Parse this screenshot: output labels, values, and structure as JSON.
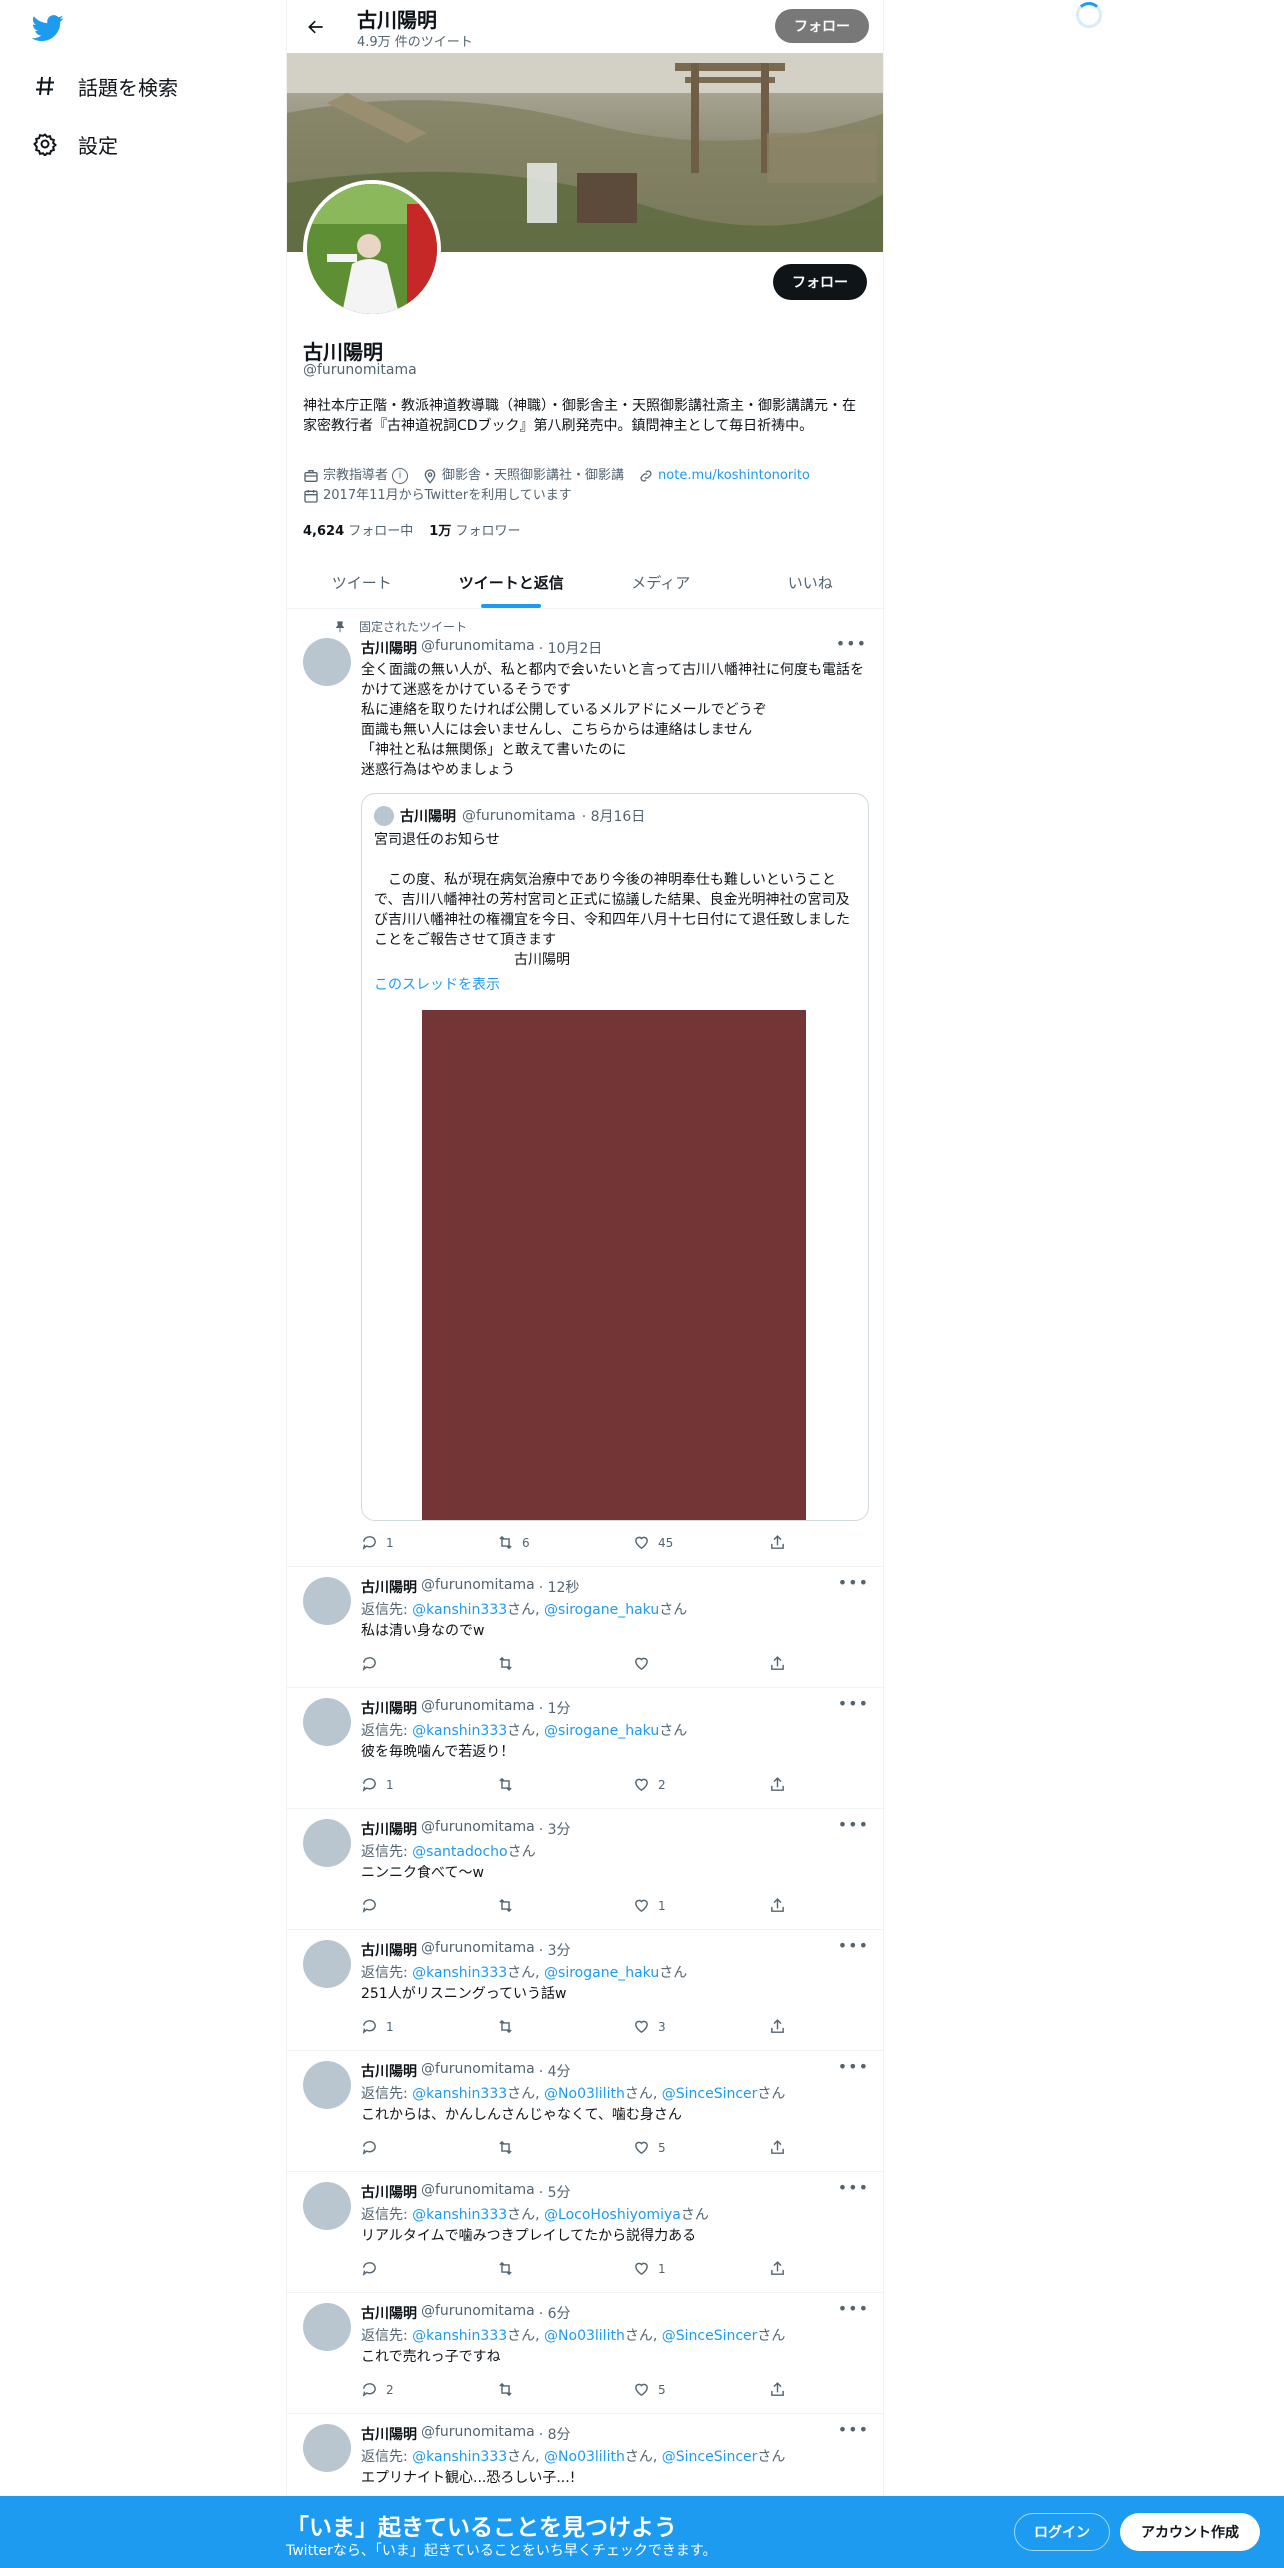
{
  "nav": {
    "explore_label": "話題を検索",
    "settings_label": "設定"
  },
  "topbar": {
    "name": "古川陽明",
    "tweet_count": "4.9万 件のツイート",
    "follow_label": "フォロー"
  },
  "profile": {
    "name": "古川陽明",
    "handle": "@furunomitama",
    "bio": "神社本庁正階・教派神道教導職（神職）・御影舎主・天照御影講社斎主・御影講講元・在家密教行者『古神道祝詞CDブック』第八刷発売中。鎮問神主として毎日祈祷中。",
    "category": "宗教指導者",
    "location": "御影舎・天照御影講社・御影講",
    "url": "note.mu/koshintonorito",
    "joined": "2017年11月からTwitterを利用しています",
    "following_count": "4,624",
    "following_label": "フォロー中",
    "followers_count": "1万",
    "followers_label": "フォロワー",
    "follow_label": "フォロー"
  },
  "tabs": [
    "ツイート",
    "ツイートと返信",
    "メディア",
    "いいね"
  ],
  "pinned_label": "固定されたツイート",
  "pinned_tweet": {
    "name": "古川陽明",
    "handle": "@furunomitama",
    "time": "· 10月2日",
    "text": "全く面識の無い人が、私と都内で会いたいと言って古川八幡神社に何度も電話をかけて迷惑をかけているそうです\n私に連絡を取りたければ公開しているメルアドにメールでどうぞ\n面識も無い人には会いませんし、こちらからは連絡はしません\n「神社と私は無関係」と敢えて書いたのに\n迷惑行為はやめましょう",
    "quote": {
      "name": "古川陽明",
      "handle": "@furunomitama",
      "time": "· 8月16日",
      "text": "宮司退任のお知らせ\n\n　この度、私が現在病気治療中であり今後の神明奉仕も難しいということで、吉川八幡神社の芳村宮司と正式に協議した結果、良金光明神社の宮司及び吉川八幡神社の権禰宜を今日、令和四年八月十七日付にて退任致しましたことをご報告させて頂きます\n　　　　　　　　　　古川陽明",
      "thread_link": "このスレッドを表示"
    },
    "replies": "1",
    "retweets": "6",
    "likes": "45"
  },
  "tweets": [
    {
      "name": "古川陽明",
      "handle": "@furunomitama",
      "time": "· 12秒",
      "reply_prefix": "返信先: ",
      "mentions": [
        "@kanshin333",
        "@sirogane_haku"
      ],
      "text": "私は清い身なのでw",
      "replies": "",
      "retweets": "",
      "likes": ""
    },
    {
      "name": "古川陽明",
      "handle": "@furunomitama",
      "time": "· 1分",
      "reply_prefix": "返信先: ",
      "mentions": [
        "@kanshin333",
        "@sirogane_haku"
      ],
      "text": "彼を毎晩噛んで若返り！",
      "replies": "1",
      "retweets": "",
      "likes": "2"
    },
    {
      "name": "古川陽明",
      "handle": "@furunomitama",
      "time": "· 3分",
      "reply_prefix": "返信先: ",
      "mentions": [
        "@santadocho"
      ],
      "text": "ニンニク食べて〜w",
      "replies": "",
      "retweets": "",
      "likes": "1"
    },
    {
      "name": "古川陽明",
      "handle": "@furunomitama",
      "time": "· 3分",
      "reply_prefix": "返信先: ",
      "mentions": [
        "@kanshin333",
        "@sirogane_haku"
      ],
      "text": "251人がリスニングっていう話w",
      "replies": "1",
      "retweets": "",
      "likes": "3"
    },
    {
      "name": "古川陽明",
      "handle": "@furunomitama",
      "time": "· 4分",
      "reply_prefix": "返信先: ",
      "mentions": [
        "@kanshin333",
        "@No03lilith",
        "@SinceSincer"
      ],
      "text": "これからは、かんしんさんじゃなくて、噛む身さん",
      "replies": "",
      "retweets": "",
      "likes": "5"
    },
    {
      "name": "古川陽明",
      "handle": "@furunomitama",
      "time": "· 5分",
      "reply_prefix": "返信先: ",
      "mentions": [
        "@kanshin333",
        "@LocoHoshiyomiya"
      ],
      "text": "リアルタイムで噛みつきプレイしてたから説得力ある",
      "replies": "",
      "retweets": "",
      "likes": "1"
    },
    {
      "name": "古川陽明",
      "handle": "@furunomitama",
      "time": "· 6分",
      "reply_prefix": "返信先: ",
      "mentions": [
        "@kanshin333",
        "@No03lilith",
        "@SinceSincer"
      ],
      "text": "これで売れっ子ですね",
      "replies": "2",
      "retweets": "",
      "likes": "5"
    },
    {
      "name": "古川陽明",
      "handle": "@furunomitama",
      "time": "· 8分",
      "reply_prefix": "返信先: ",
      "mentions": [
        "@kanshin333",
        "@No03lilith",
        "@SinceSincer"
      ],
      "text": "エプリナイト観心...恐ろしい子...!",
      "replies": "",
      "retweets": "",
      "likes": ""
    }
  ],
  "mention_suffix": "さん",
  "mention_sep": ", ",
  "bottom": {
    "title": "「いま」起きていることを見つけよう",
    "subtitle": "Twitterなら、「いま」起きていることをいち早くチェックできます。",
    "login_label": "ログイン",
    "signup_label": "アカウント作成"
  },
  "colors": {
    "accent": "#1d9bf0",
    "media_placeholder": "#733535"
  }
}
